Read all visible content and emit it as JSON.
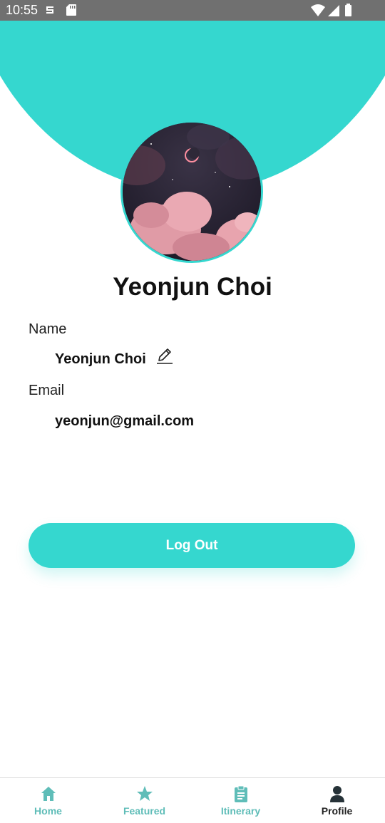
{
  "status_bar": {
    "time": "10:55"
  },
  "profile": {
    "display_name": "Yeonjun Choi",
    "name_label": "Name",
    "name_value": "Yeonjun Choi",
    "email_label": "Email",
    "email_value": "yeonjun@gmail.com"
  },
  "actions": {
    "logout_label": "Log Out"
  },
  "bottom_nav": {
    "items": [
      {
        "label": "Home",
        "icon": "home-icon"
      },
      {
        "label": "Featured",
        "icon": "star-icon"
      },
      {
        "label": "Itinerary",
        "icon": "clipboard-icon"
      },
      {
        "label": "Profile",
        "icon": "user-icon"
      }
    ],
    "active": "Profile"
  },
  "colors": {
    "accent": "#35d7cf",
    "nav_inactive": "#5fbdb8",
    "nav_active": "#222222"
  }
}
